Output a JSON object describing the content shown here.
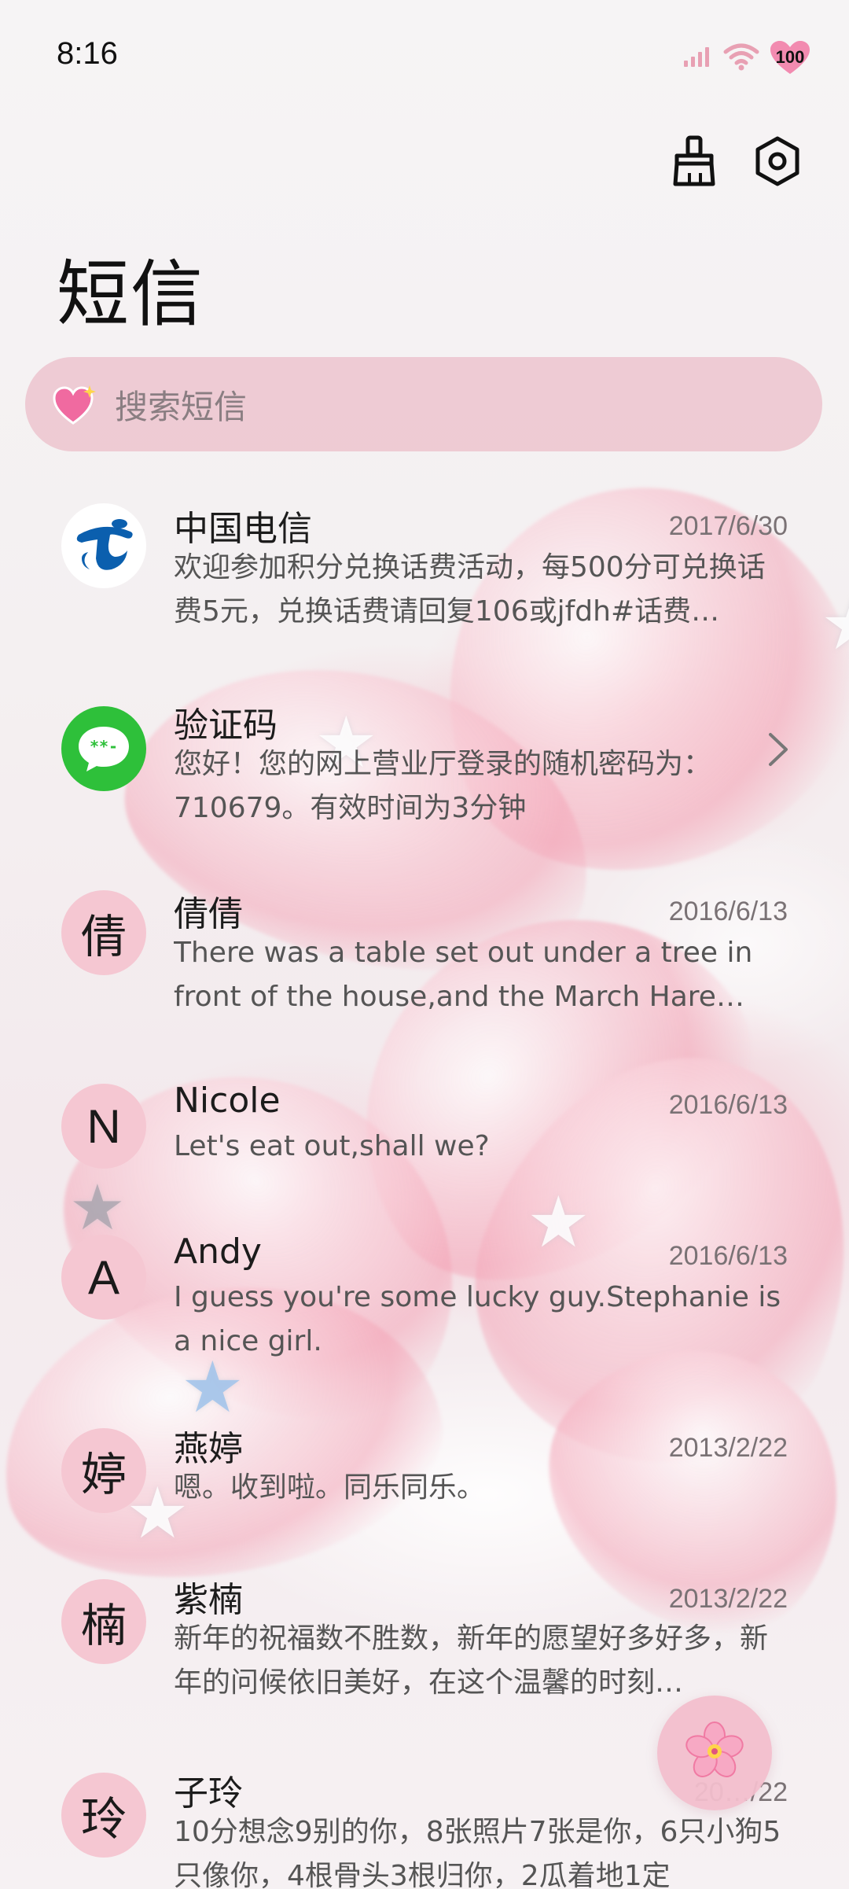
{
  "status_bar": {
    "time": "8:16",
    "battery": "100"
  },
  "header": {
    "title": "短信",
    "clean_icon": "broom-icon",
    "settings_icon": "settings-hexagon-icon"
  },
  "search": {
    "placeholder": "搜索短信",
    "icon": "sparkling-heart-icon"
  },
  "conversations": [
    {
      "name": "中国电信",
      "date": "2017/6/30",
      "preview": "欢迎参加积分兑换话费活动，每500分可兑换话费5元，兑换话费请回复106或jfdh#话费…",
      "avatar_type": "china-telecom-logo"
    },
    {
      "name": "验证码",
      "date": "",
      "preview": "您好！您的网上营业厅登录的随机密码为：710679。有效时间为3分钟",
      "avatar_type": "verification-code-icon"
    },
    {
      "name": "倩倩",
      "date": "2016/6/13",
      "preview": "There was a table set out under a tree in front of the house,and the March Hare an…",
      "avatar_text": "倩"
    },
    {
      "name": "Nicole",
      "date": "2016/6/13",
      "preview": "Let's eat out,shall we?",
      "avatar_text": "N"
    },
    {
      "name": "Andy",
      "date": "2016/6/13",
      "preview": "I guess you're some lucky guy.Stephanie is a nice girl.",
      "avatar_text": "A"
    },
    {
      "name": "燕婷",
      "date": "2013/2/22",
      "preview": "嗯。收到啦。同乐同乐。",
      "avatar_text": "婷"
    },
    {
      "name": "紫楠",
      "date": "2013/2/22",
      "preview": "新年的祝福数不胜数，新年的愿望好多好多，新年的问候依旧美好，在这个温馨的时刻…",
      "avatar_text": "楠"
    },
    {
      "name": "子玲",
      "date": "20…/22",
      "preview": "10分想念9别的你，8张照片7张是你，6只小狗5只像你，4根骨头3根归你，2瓜着地1定",
      "avatar_text": "玲"
    }
  ],
  "fab": {
    "icon": "cherry-blossom-icon"
  },
  "colors": {
    "avatar_bg": "#f5c7d2",
    "search_bg": "#ecc4ce",
    "telecom_blue": "#0b5fae",
    "verify_green": "#2ec03a"
  }
}
